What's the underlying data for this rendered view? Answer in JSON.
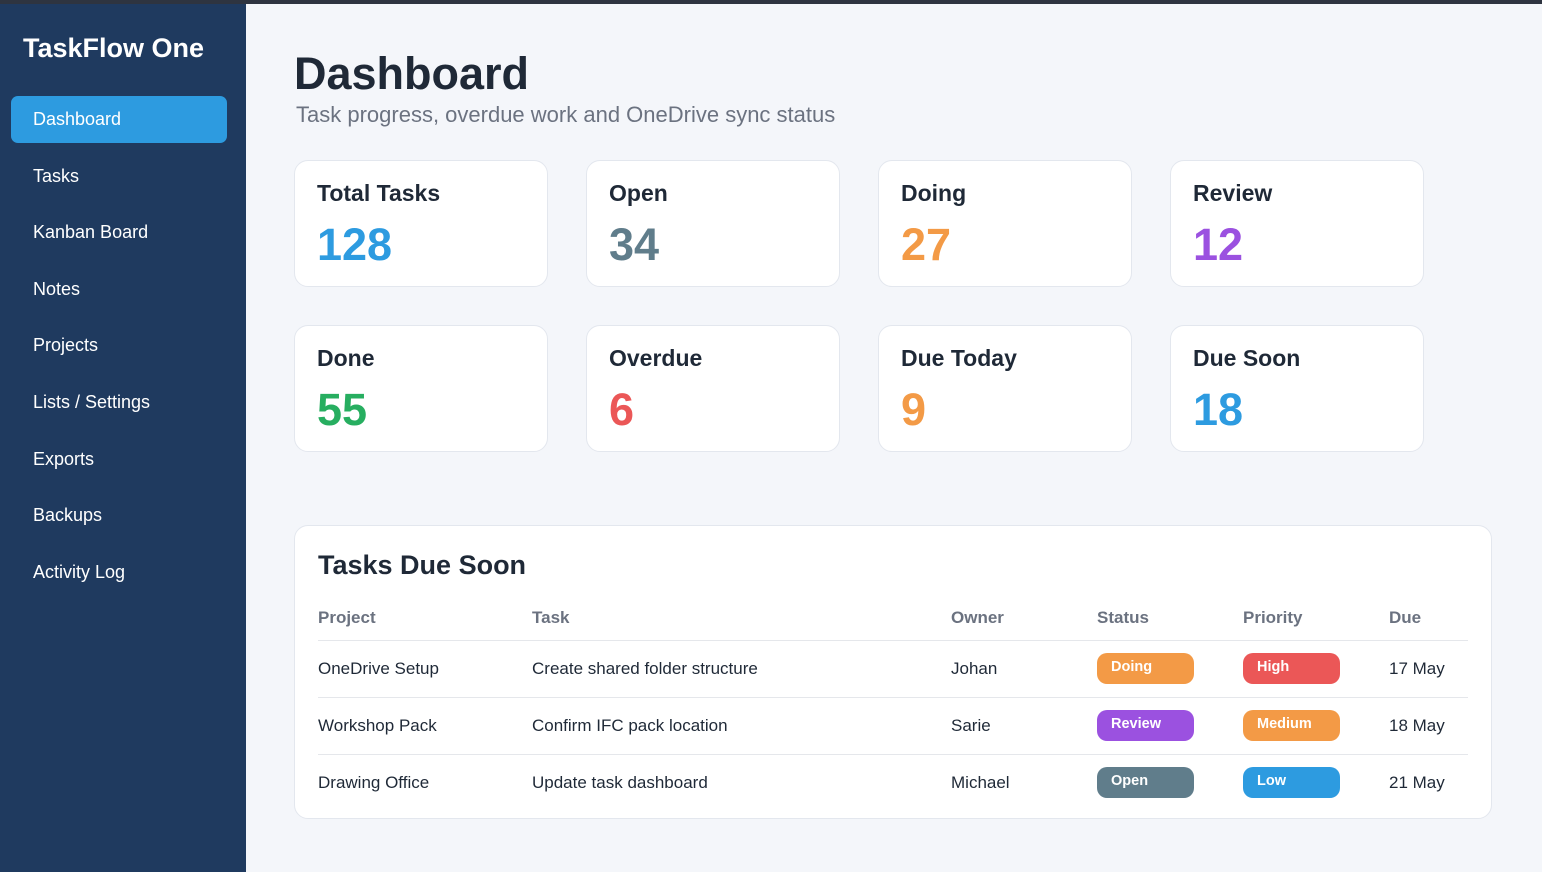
{
  "colors": {
    "sidebar_bg": "#1f3a5f",
    "nav_active_bg": "#2d9be0",
    "blue": "#2d9be0",
    "slate": "#607d8b",
    "orange": "#f39a46",
    "purple": "#9b51e0",
    "green": "#27ae60",
    "red": "#eb5757"
  },
  "sidebar": {
    "brand": "TaskFlow One",
    "items": [
      {
        "label": "Dashboard",
        "active": true
      },
      {
        "label": "Tasks"
      },
      {
        "label": "Kanban Board"
      },
      {
        "label": "Notes"
      },
      {
        "label": "Projects"
      },
      {
        "label": "Lists / Settings"
      },
      {
        "label": "Exports"
      },
      {
        "label": "Backups"
      },
      {
        "label": "Activity Log"
      }
    ]
  },
  "header": {
    "title": "Dashboard",
    "subtitle": "Task progress, overdue work and OneDrive sync status"
  },
  "stats": [
    {
      "label": "Total Tasks",
      "value": "128",
      "color": "#2d9be0"
    },
    {
      "label": "Open",
      "value": "34",
      "color": "#607d8b"
    },
    {
      "label": "Doing",
      "value": "27",
      "color": "#f39a46"
    },
    {
      "label": "Review",
      "value": "12",
      "color": "#9b51e0"
    },
    {
      "label": "Done",
      "value": "55",
      "color": "#27ae60"
    },
    {
      "label": "Overdue",
      "value": "6",
      "color": "#eb5757"
    },
    {
      "label": "Due Today",
      "value": "9",
      "color": "#f39a46"
    },
    {
      "label": "Due Soon",
      "value": "18",
      "color": "#2d9be0"
    }
  ],
  "due_soon": {
    "title": "Tasks Due Soon",
    "columns": [
      "Project",
      "Task",
      "Owner",
      "Status",
      "Priority",
      "Due"
    ],
    "rows": [
      {
        "project": "OneDrive Setup",
        "task": "Create shared folder structure",
        "owner": "Johan",
        "status": {
          "label": "Doing",
          "color": "#f39a46"
        },
        "priority": {
          "label": "High",
          "color": "#eb5757"
        },
        "due": "17 May"
      },
      {
        "project": "Workshop Pack",
        "task": "Confirm IFC pack location",
        "owner": "Sarie",
        "status": {
          "label": "Review",
          "color": "#9b51e0"
        },
        "priority": {
          "label": "Medium",
          "color": "#f39a46"
        },
        "due": "18 May"
      },
      {
        "project": "Drawing Office",
        "task": "Update task dashboard",
        "owner": "Michael",
        "status": {
          "label": "Open",
          "color": "#607d8b"
        },
        "priority": {
          "label": "Low",
          "color": "#2d9be0"
        },
        "due": "21 May"
      }
    ]
  }
}
